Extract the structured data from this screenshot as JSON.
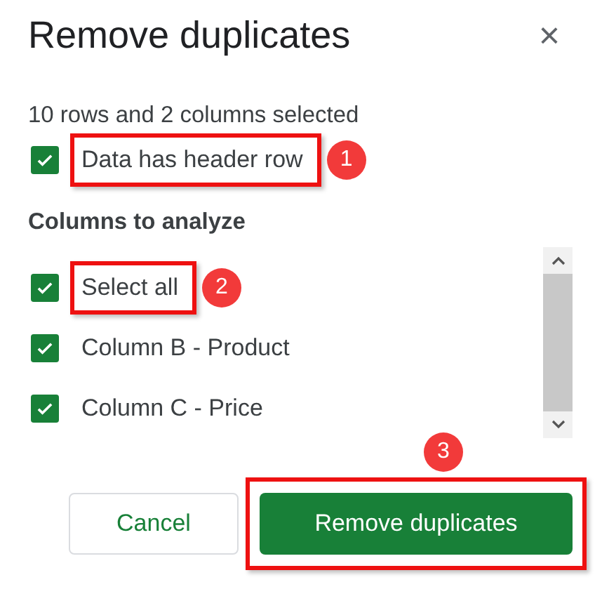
{
  "dialog": {
    "title": "Remove duplicates",
    "close": "×"
  },
  "selection_summary": "10 rows and 2 columns selected",
  "header_row": {
    "label": "Data has header row",
    "checked": true,
    "callout": "1"
  },
  "columns_heading": "Columns to analyze",
  "columns": [
    {
      "label": "Select all",
      "checked": true,
      "callout": "2"
    },
    {
      "label": "Column B - Product",
      "checked": true
    },
    {
      "label": "Column C - Price",
      "checked": true
    }
  ],
  "buttons": [
    {
      "kind": "secondary",
      "label": "Cancel"
    },
    {
      "kind": "primary",
      "label": "Remove duplicates",
      "callout": "3"
    }
  ]
}
